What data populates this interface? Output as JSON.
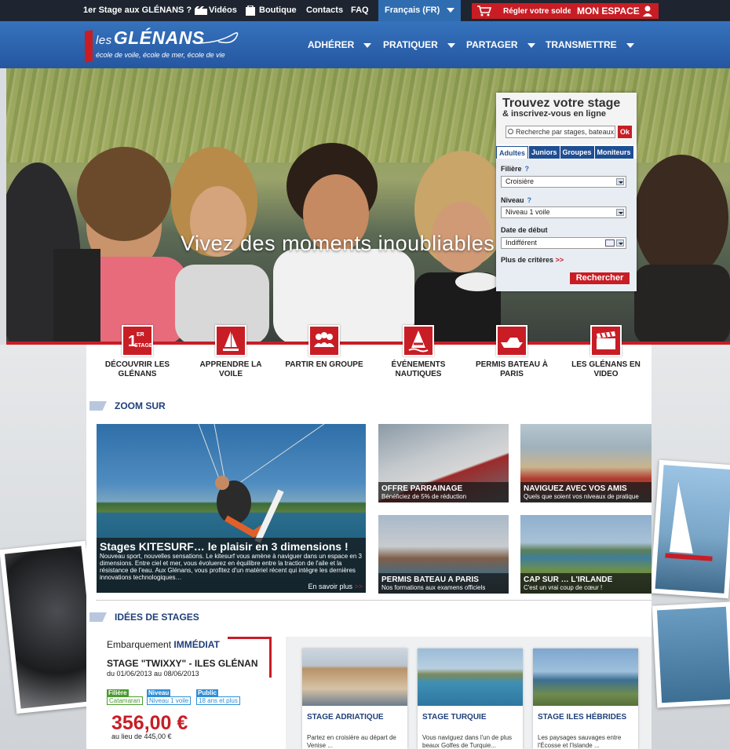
{
  "topbar": {
    "first_stage": "1er Stage aux GLÉNANS ?",
    "videos": "Vidéos",
    "boutique": "Boutique",
    "contacts": "Contacts",
    "faq": "FAQ",
    "language": "Français (FR)",
    "regler_solde": "Régler votre solde",
    "mon_espace": "MON ESPACE"
  },
  "header": {
    "logo_prefix": "les",
    "logo_name": "GLÉNANS",
    "tagline": "école de voile, école de mer, école de vie",
    "nav": [
      "ADHÉRER",
      "PRATIQUER",
      "PARTAGER",
      "TRANSMETTRE"
    ]
  },
  "hero": {
    "headline": "Vivez des moments inoubliables"
  },
  "search_widget": {
    "title": "Trouvez votre stage",
    "subtitle": "& inscrivez-vous en ligne",
    "search_placeholder": "Recherche par stages, bateaux...",
    "ok_label": "Ok",
    "tabs": [
      "Adultes",
      "Juniors",
      "Groupes",
      "Moniteurs"
    ],
    "active_tab": "Adultes",
    "filiere_label": "Filière",
    "filiere_value": "Croisière",
    "niveau_label": "Niveau",
    "niveau_value": "Niveau 1 voile",
    "date_label": "Date de début",
    "date_value": "Indifférent",
    "more_criteria": "Plus de critères",
    "more_arrow": ">>",
    "help_mark": "?",
    "search_button": "Rechercher"
  },
  "quick_links": [
    {
      "label": "DÉCOUVRIR LES GLÉNANS",
      "icon": "first-stage-icon",
      "icon_text_top": "1",
      "icon_text_sup": "ER",
      "icon_text_bottom": "STAGE"
    },
    {
      "label": "APPRENDRE LA VOILE",
      "icon": "sailboat-icon"
    },
    {
      "label": "PARTIR EN GROUPE",
      "icon": "group-icon"
    },
    {
      "label": "ÉVÉNEMENTS NAUTIQUES",
      "icon": "buoy-icon"
    },
    {
      "label": "PERMIS BATEAU À PARIS",
      "icon": "motorboat-icon"
    },
    {
      "label": "LES GLÉNANS EN VIDEO",
      "icon": "clapperboard-icon"
    }
  ],
  "zoom": {
    "section_title": "ZOOM SUR",
    "featured": {
      "title": "Stages KITESURF… le plaisir en 3 dimensions !",
      "text": "Nouveau sport, nouvelles sensations. Le kitesurf vous amène à naviguer dans un espace en 3 dimensions. Entre ciel et mer, vous évoluerez en équilibre entre la traction de l'aile et la résistance de l'eau. Aux Glénans, vous profitez d'un matériel récent qui intègre les dernières innovations technologiques…",
      "more": "En savoir plus",
      "more_arrow": ">>"
    },
    "tiles": [
      {
        "title": "OFFRE PARRAINAGE",
        "subtitle": "Bénéficiez de 5% de réduction"
      },
      {
        "title": "NAVIGUEZ AVEC VOS AMIS",
        "subtitle": "Quels que soient vos niveaux de pratique"
      },
      {
        "title": "PERMIS BATEAU A PARIS",
        "subtitle": "Nos formations aux examens officiels"
      },
      {
        "title": "CAP SUR … L'IRLANDE",
        "subtitle": "C'est un vrai coup de cœur !"
      }
    ]
  },
  "ideas": {
    "section_title": "IDÉES DE STAGES",
    "embark_prefix": "Embarquement",
    "embark_highlight": "IMMÉDIAT",
    "stage_title": "STAGE \"TWIXXY\" - ILES GLÉNAN",
    "stage_dates": "du 01/06/2013 au 08/06/2013",
    "badges": [
      {
        "head": "Filière",
        "value": "Catamaran",
        "color": "#4a9b2f"
      },
      {
        "head": "Niveau",
        "value": "Niveau 1 voile",
        "color": "#2f8fd6"
      },
      {
        "head": "Public",
        "value": "18 ans et plus",
        "color": "#2f8fd6"
      }
    ],
    "price": "356,00 €",
    "old_price": "au lieu de 445,00 €",
    "cards": [
      {
        "title": "STAGE ADRIATIQUE",
        "text": "Partez en croisière au départ de Venise ..."
      },
      {
        "title": "STAGE TURQUIE",
        "text": "Vous naviguez dans l'un de plus beaux Golfes de Turquie..."
      },
      {
        "title": "STAGE ILES HÉBRIDES",
        "text": "Les paysages sauvages entre l'Écosse et l'Islande ..."
      }
    ]
  },
  "colors": {
    "brand_red": "#c81d25",
    "brand_blue": "#2c62a8",
    "title_blue": "#1f3f7a"
  }
}
